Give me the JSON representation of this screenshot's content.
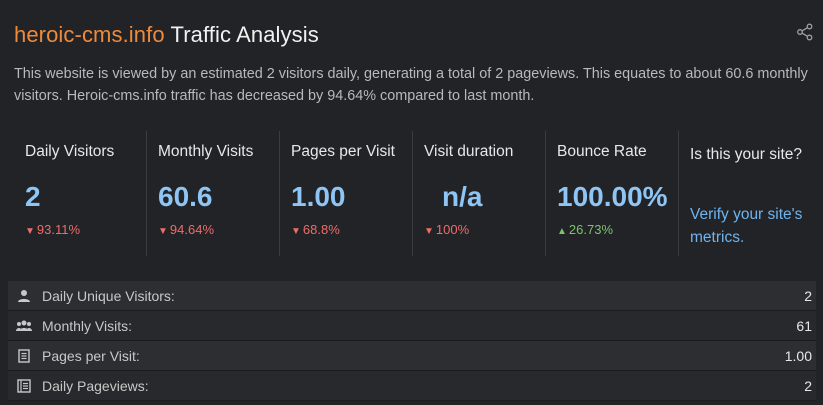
{
  "header": {
    "domain": "heroic-cms.info",
    "title_suffix": "Traffic Analysis",
    "description": "This website is viewed by an estimated 2 visitors daily, generating a total of 2 pageviews. This equates to about 60.6 monthly visitors. Heroic-cms.info traffic has decreased by 94.64% compared to last month.",
    "share_icon": "share-icon"
  },
  "metrics": [
    {
      "label": "Daily Visitors",
      "value": "2",
      "change": "93.11%",
      "direction": "down"
    },
    {
      "label": "Monthly Visits",
      "value": "60.6",
      "change": "94.64%",
      "direction": "down"
    },
    {
      "label": "Pages per Visit",
      "value": "1.00",
      "change": "68.8%",
      "direction": "down"
    },
    {
      "label": "Visit duration",
      "value": "n/a",
      "change": "100%",
      "direction": "down"
    },
    {
      "label": "Bounce Rate",
      "value": "100.00%",
      "change": "26.73%",
      "direction": "up"
    }
  ],
  "verify": {
    "title": "Is this your site?",
    "link": "Verify your site's metrics."
  },
  "stats": [
    {
      "label": "Daily Unique Visitors:",
      "value": "2",
      "icon": "person-icon"
    },
    {
      "label": "Monthly Visits:",
      "value": "61",
      "icon": "people-icon"
    },
    {
      "label": "Pages per Visit:",
      "value": "1.00",
      "icon": "page-icon"
    },
    {
      "label": "Daily Pageviews:",
      "value": "2",
      "icon": "pages-icon"
    }
  ],
  "colors": {
    "accent": "#ee8a3c",
    "value_blue": "#8ec5f5",
    "link_blue": "#6fb4f0",
    "down_red": "#ee6b6b",
    "up_green": "#7bc46b"
  }
}
